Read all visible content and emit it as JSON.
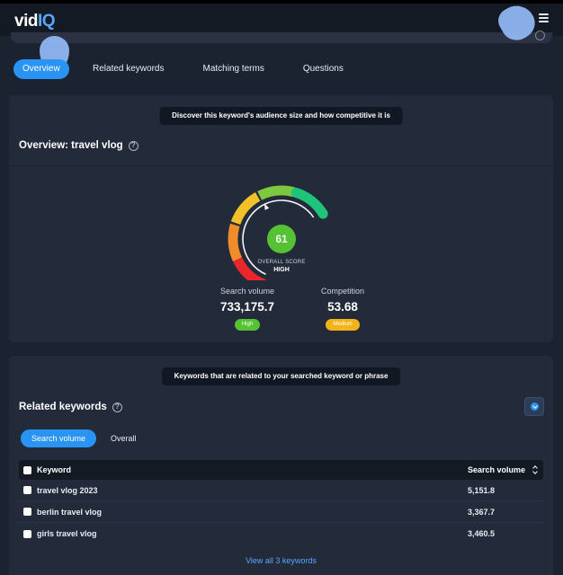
{
  "header": {
    "logo_text_a": "vid",
    "logo_text_b": "IQ",
    "menu_icon": "hamburger-menu-icon"
  },
  "tabs": [
    {
      "label": "Overview",
      "active": true
    },
    {
      "label": "Related keywords",
      "active": false
    },
    {
      "label": "Matching terms",
      "active": false
    },
    {
      "label": "Questions",
      "active": false
    }
  ],
  "overview": {
    "banner": "Discover this keyword's audience size and how competitive it is",
    "title": "Overview: travel vlog",
    "help_icon": "question-circle-icon",
    "score": "61",
    "score_fraction": 0.61,
    "score_label": "OVERALL SCORE",
    "score_level": "HIGH",
    "search_volume": {
      "label": "Search volume",
      "value": "733,175.7",
      "badge": "High",
      "badge_color": "#55c234"
    },
    "competition": {
      "label": "Competition",
      "value": "53.68",
      "badge": "Medium",
      "badge_color": "#f2b418"
    },
    "gauge_colors": [
      "#e8262b",
      "#f08c2a",
      "#f4c02a",
      "#7ec83e",
      "#1ec47a"
    ]
  },
  "related": {
    "banner": "Keywords that are related to your searched keyword or phrase",
    "title": "Related keywords",
    "download_icon": "download-circle-icon",
    "subtabs": [
      {
        "label": "Search volume",
        "active": true
      },
      {
        "label": "Overall",
        "active": false
      }
    ],
    "columns": {
      "keyword": "Keyword",
      "volume": "Search volume"
    },
    "rows": [
      {
        "keyword": "travel vlog 2023",
        "volume": "5,151.8"
      },
      {
        "keyword": "berlin travel vlog",
        "volume": "3,367.7"
      },
      {
        "keyword": "girls travel vlog",
        "volume": "3,460.5"
      }
    ],
    "view_all": "View all 3 keywords"
  },
  "accent_color": "#2a94f4"
}
